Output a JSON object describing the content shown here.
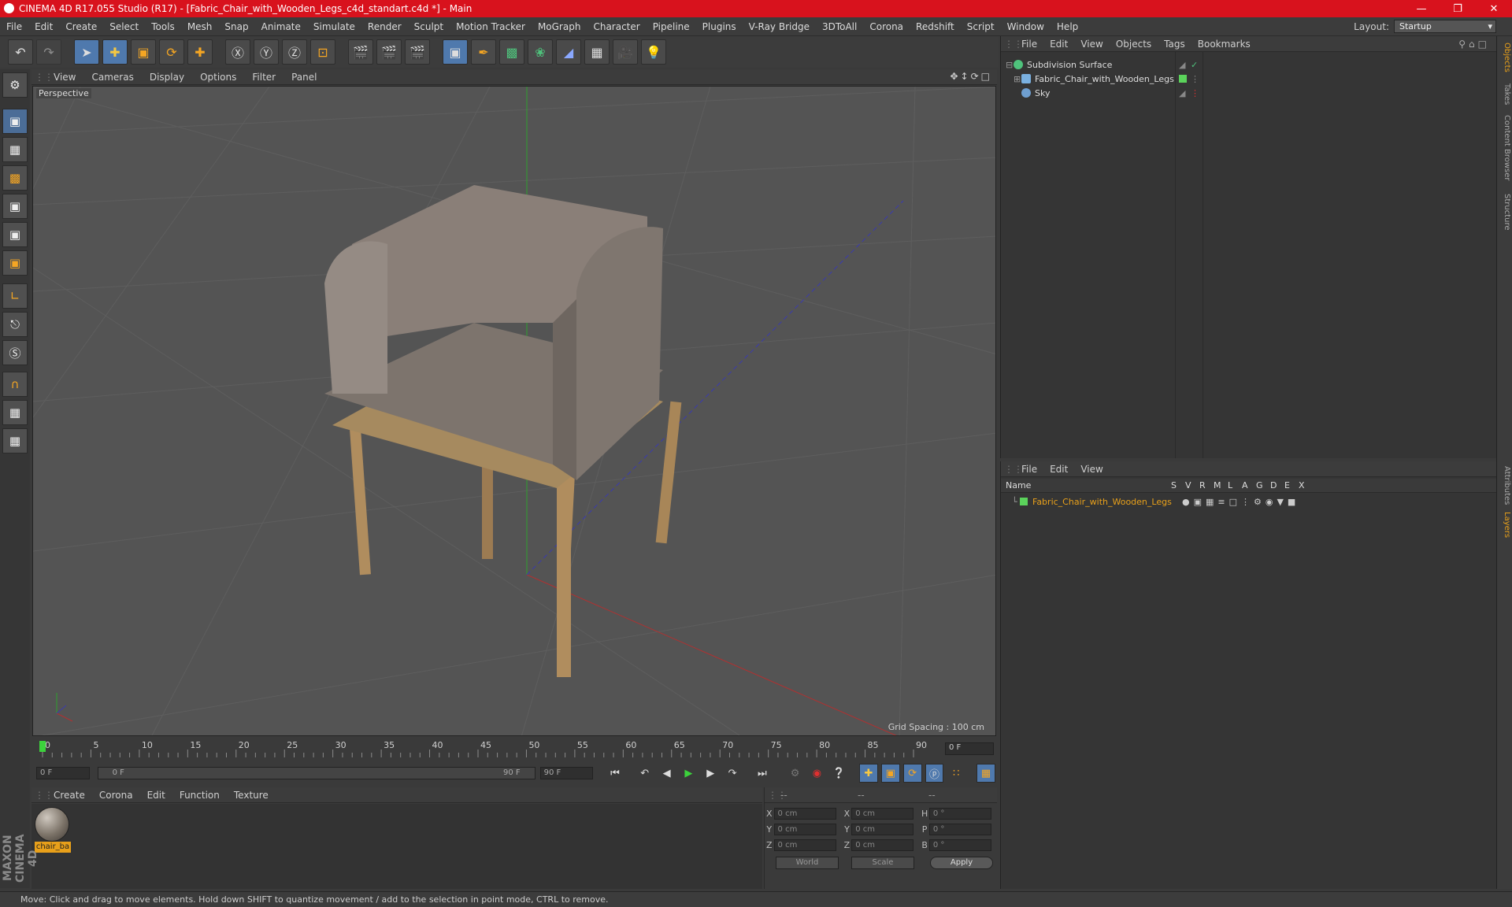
{
  "window": {
    "title": "CINEMA 4D R17.055 Studio (R17) - [Fabric_Chair_with_Wooden_Legs_c4d_standart.c4d *] - Main"
  },
  "menu": [
    "File",
    "Edit",
    "Create",
    "Select",
    "Tools",
    "Mesh",
    "Snap",
    "Animate",
    "Simulate",
    "Render",
    "Sculpt",
    "Motion Tracker",
    "MoGraph",
    "Character",
    "Pipeline",
    "Plugins",
    "V-Ray Bridge",
    "3DToAll",
    "Corona",
    "Redshift",
    "Script",
    "Window",
    "Help"
  ],
  "layout": {
    "label": "Layout:",
    "value": "Startup"
  },
  "viewport": {
    "menu": [
      "View",
      "Cameras",
      "Display",
      "Options",
      "Filter",
      "Panel"
    ],
    "camera_label": "Perspective",
    "grid_spacing": "Grid Spacing : 100 cm"
  },
  "timeline": {
    "ticks": [
      "0",
      "5",
      "10",
      "15",
      "20",
      "25",
      "30",
      "35",
      "40",
      "45",
      "50",
      "55",
      "60",
      "65",
      "70",
      "75",
      "80",
      "85",
      "90"
    ],
    "current_frame": "0 F"
  },
  "transport": {
    "start": "0 F",
    "slider_start": "0 F",
    "slider_end": "90 F",
    "end": "90 F"
  },
  "materials": {
    "menu": [
      "Create",
      "Corona",
      "Edit",
      "Function",
      "Texture"
    ],
    "items": [
      {
        "name": "chair_ba"
      }
    ]
  },
  "coords": {
    "headers": [
      "--",
      "--",
      "--"
    ],
    "rows": [
      {
        "l1": "X",
        "v1": "0 cm",
        "l2": "X",
        "v2": "0 cm",
        "l3": "H",
        "v3": "0 °"
      },
      {
        "l1": "Y",
        "v1": "0 cm",
        "l2": "Y",
        "v2": "0 cm",
        "l3": "P",
        "v3": "0 °"
      },
      {
        "l1": "Z",
        "v1": "0 cm",
        "l2": "Z",
        "v2": "0 cm",
        "l3": "B",
        "v3": "0 °"
      }
    ],
    "world": "World",
    "scale": "Scale",
    "apply": "Apply"
  },
  "objects": {
    "menu": [
      "File",
      "Edit",
      "View",
      "Objects",
      "Tags",
      "Bookmarks"
    ],
    "items": [
      {
        "name": "Subdivision Surface",
        "color": "#4fc27c"
      },
      {
        "name": "Fabric_Chair_with_Wooden_Legs",
        "color": "#7ab0e0"
      },
      {
        "name": "Sky",
        "color": "#6f9fd0"
      }
    ]
  },
  "layers": {
    "menu": [
      "File",
      "Edit",
      "View"
    ],
    "header": {
      "name": "Name",
      "cols": [
        "S",
        "V",
        "R",
        "M",
        "L",
        "A",
        "G",
        "D",
        "E",
        "X"
      ]
    },
    "items": [
      {
        "name": "Fabric_Chair_with_Wooden_Legs",
        "color": "#5bd35b"
      }
    ]
  },
  "side_tabs": [
    "Objects",
    "Takes",
    "Content Browser",
    "Structure",
    "Attributes",
    "Layers"
  ],
  "status": "Move: Click and drag to move elements. Hold down SHIFT to quantize movement / add to the selection in point mode, CTRL to remove.",
  "brand": "MAXON CINEMA 4D",
  "colors": {
    "titlebar": "#d8121d",
    "accent_blue": "#4f79ad",
    "selected_orange": "#e8a01a"
  }
}
